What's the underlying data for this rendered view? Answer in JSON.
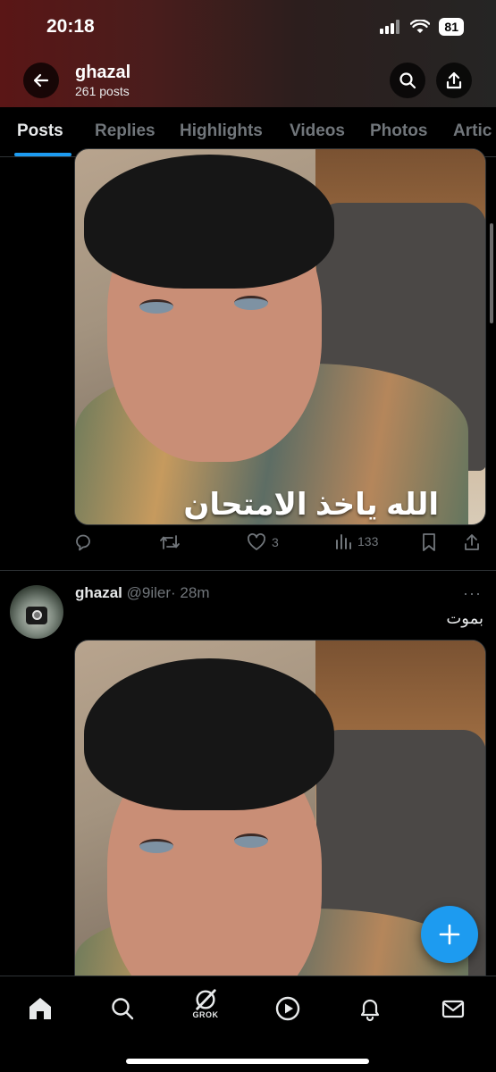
{
  "status_bar": {
    "time": "20:18",
    "battery": "81"
  },
  "profile": {
    "name": "ghazal",
    "post_count": "261 posts"
  },
  "tabs": [
    {
      "label": "Posts",
      "active": true
    },
    {
      "label": "Replies",
      "active": false
    },
    {
      "label": "Highlights",
      "active": false
    },
    {
      "label": "Videos",
      "active": false
    },
    {
      "label": "Photos",
      "active": false
    },
    {
      "label": "Artic",
      "active": false
    }
  ],
  "post1": {
    "media_caption": "الله ياخذ الامتحان",
    "actions": {
      "reply_count": "",
      "retweet_count": "",
      "like_count": "3",
      "view_count": "133"
    }
  },
  "post2": {
    "author_name": "ghazal",
    "author_handle": "@9iler",
    "time": "· 28m",
    "more": "···",
    "text": "بموت"
  },
  "bottom_nav": {
    "grok_label": "GROK"
  },
  "colors": {
    "accent": "#1d9bf0",
    "muted": "#71767b",
    "text": "#e7e9ea",
    "banner": "#4a1d1c"
  }
}
